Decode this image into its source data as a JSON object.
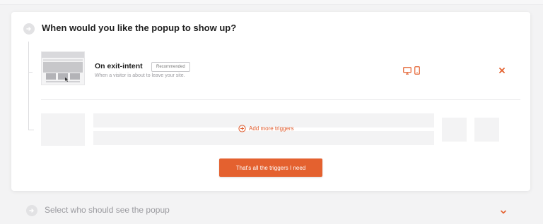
{
  "step1": {
    "title": "When would you like the popup to show up?"
  },
  "trigger": {
    "name": "On exit-intent",
    "badge": "Recommended",
    "description": "When a visitor is about to leave your site.",
    "devices": [
      "desktop-icon",
      "mobile-icon"
    ]
  },
  "add_more_label": "Add more triggers",
  "cta_label": "That's all the triggers I need",
  "step2": {
    "title": "Select who should see the popup"
  },
  "colors": {
    "accent": "#e4612f",
    "muted_text": "#9a9a9f",
    "placeholder": "#f3f3f4"
  }
}
